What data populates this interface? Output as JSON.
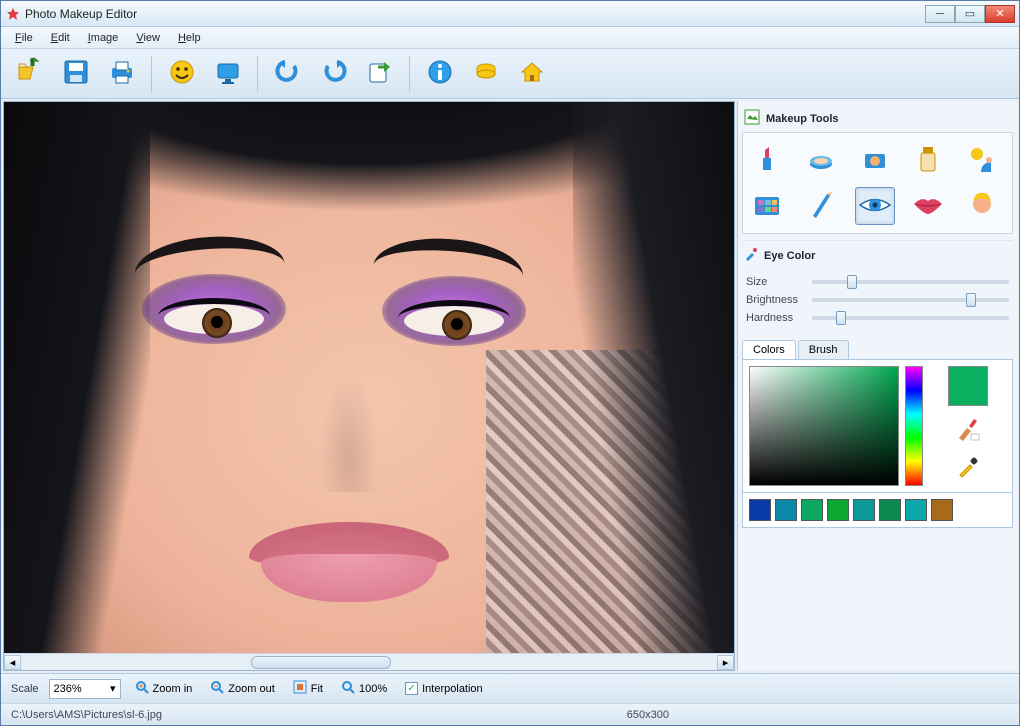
{
  "window": {
    "title": "Photo Makeup Editor"
  },
  "menubar": [
    "File",
    "Edit",
    "Image",
    "View",
    "Help"
  ],
  "toolbar": [
    {
      "name": "open",
      "icon": "open-icon",
      "tip": "Open"
    },
    {
      "name": "save",
      "icon": "save-icon",
      "tip": "Save"
    },
    {
      "name": "print",
      "icon": "print-icon",
      "tip": "Print"
    },
    {
      "sep": true
    },
    {
      "name": "smile",
      "icon": "smile-icon",
      "tip": "Effects"
    },
    {
      "name": "display",
      "icon": "display-icon",
      "tip": "Screen"
    },
    {
      "sep": true
    },
    {
      "name": "undo",
      "icon": "undo-icon",
      "tip": "Undo"
    },
    {
      "name": "redo",
      "icon": "redo-icon",
      "tip": "Redo"
    },
    {
      "name": "export",
      "icon": "export-icon",
      "tip": "Export"
    },
    {
      "sep": true
    },
    {
      "name": "info",
      "icon": "info-icon",
      "tip": "Info"
    },
    {
      "name": "coins",
      "icon": "coins-icon",
      "tip": "Buy"
    },
    {
      "name": "home",
      "icon": "home-icon",
      "tip": "Home"
    }
  ],
  "makeup": {
    "title": "Makeup Tools",
    "tools": [
      {
        "name": "lipstick",
        "icon": "lipstick-icon"
      },
      {
        "name": "powder",
        "icon": "powder-icon"
      },
      {
        "name": "rouge",
        "icon": "rouge-icon"
      },
      {
        "name": "foundation",
        "icon": "foundation-icon"
      },
      {
        "name": "tan",
        "icon": "tan-icon"
      },
      {
        "name": "eyeshadow",
        "icon": "eyeshadow-icon"
      },
      {
        "name": "eyeliner",
        "icon": "eyeliner-icon"
      },
      {
        "name": "eyecolor",
        "icon": "eye-icon",
        "selected": true
      },
      {
        "name": "lips",
        "icon": "lips-icon"
      },
      {
        "name": "hair",
        "icon": "hair-icon"
      }
    ]
  },
  "eyecolor": {
    "title": "Eye Color",
    "sliders": [
      {
        "label": "Size",
        "value": 18
      },
      {
        "label": "Brightness",
        "value": 78
      },
      {
        "label": "Hardness",
        "value": 12
      }
    ],
    "tabs": [
      "Colors",
      "Brush"
    ],
    "active_tab": "Colors",
    "current_color": "#0ab060",
    "swatches": [
      "#0a3aa8",
      "#0a8aa8",
      "#0aa860",
      "#0aa830",
      "#0a9a9a",
      "#0a8a50",
      "#0aa8a8",
      "#a86a1a"
    ]
  },
  "status": {
    "scale_label": "Scale",
    "scale_value": "236%",
    "zoom_in": "Zoom in",
    "zoom_out": "Zoom out",
    "fit": "Fit",
    "hundred": "100%",
    "interp": "Interpolation",
    "interp_checked": true,
    "path": "C:\\Users\\AMS\\Pictures\\sl-6.jpg",
    "dims": "650x300"
  }
}
